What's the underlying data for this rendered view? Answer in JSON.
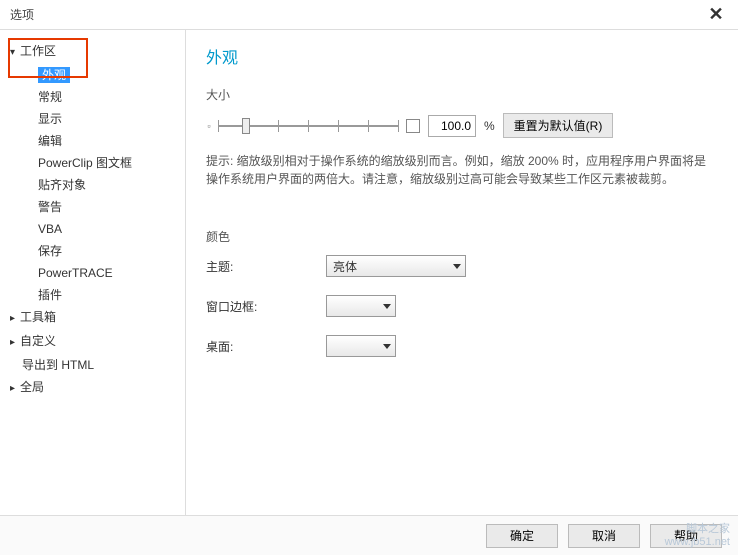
{
  "window": {
    "title": "选项"
  },
  "tree": {
    "items": [
      {
        "label": "工作区",
        "expand": true,
        "level": 1
      },
      {
        "label": "外观",
        "level": 2,
        "selected": true
      },
      {
        "label": "常规",
        "level": 2
      },
      {
        "label": "显示",
        "level": 2
      },
      {
        "label": "编辑",
        "level": 2
      },
      {
        "label": "PowerClip 图文框",
        "level": 2
      },
      {
        "label": "贴齐对象",
        "level": 2
      },
      {
        "label": "警告",
        "level": 2
      },
      {
        "label": "VBA",
        "level": 2
      },
      {
        "label": "保存",
        "level": 2
      },
      {
        "label": "PowerTRACE",
        "level": 2
      },
      {
        "label": "插件",
        "level": 2
      },
      {
        "label": "工具箱",
        "expand": false,
        "level": 1,
        "caret": true
      },
      {
        "label": "自定义",
        "expand": false,
        "level": 1,
        "caret": true
      },
      {
        "label": "导出到 HTML",
        "level": 0
      },
      {
        "label": "全局",
        "expand": false,
        "level": 0,
        "caret": true
      }
    ]
  },
  "panel": {
    "title": "外观",
    "size_section": "大小",
    "size_value": "100.0",
    "percent": "%",
    "reset": "重置为默认值(R)",
    "hint": "提示: 缩放级别相对于操作系统的缩放级别而言。例如，缩放 200% 时，应用程序用户界面将是操作系统用户界面的两倍大。请注意，缩放级别过高可能会导致某些工作区元素被裁剪。",
    "color_section": "颜色",
    "theme_label": "主题:",
    "theme_value": "亮体",
    "border_label": "窗口边框:",
    "desktop_label": "桌面:"
  },
  "footer": {
    "ok": "确定",
    "cancel": "取消",
    "help": "帮助"
  },
  "watermark": {
    "l1": "脚本之家",
    "l2": "www.jb51.net"
  }
}
